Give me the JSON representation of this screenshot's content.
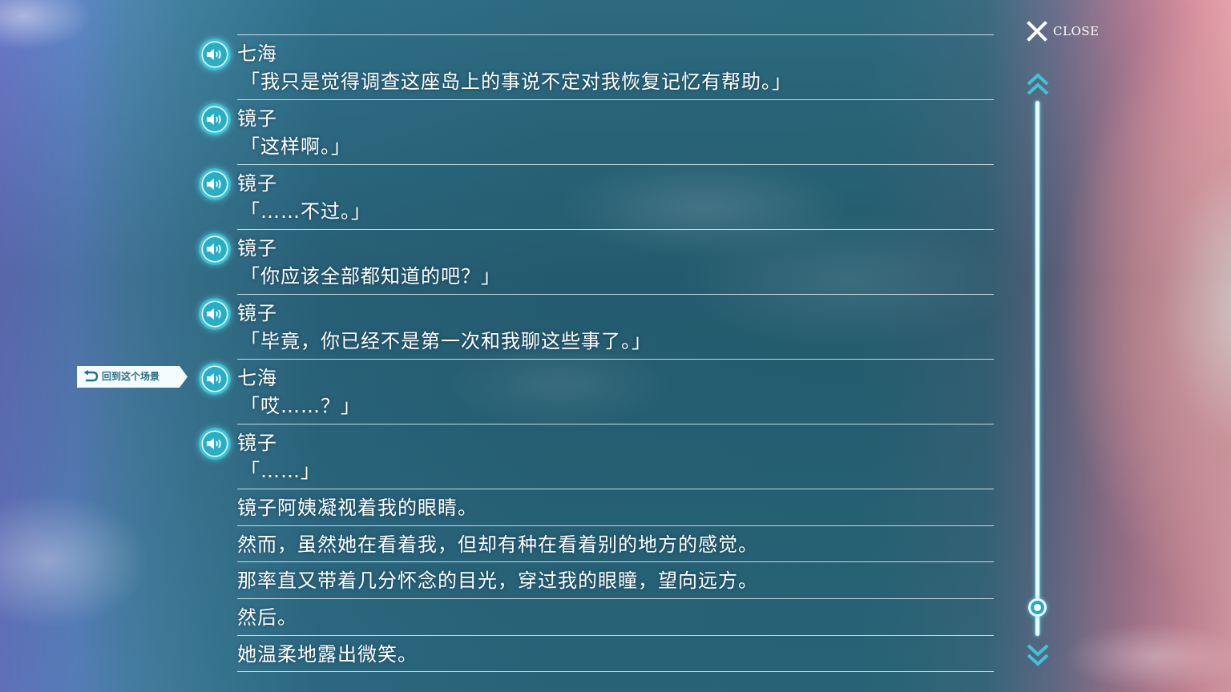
{
  "backlog": {
    "entries": [
      {
        "type": "voiced",
        "speaker": "七海",
        "text": "「我只是觉得调查这座岛上的事说不定对我恢复记忆有帮助。」"
      },
      {
        "type": "voiced",
        "speaker": "镜子",
        "text": "「这样啊。」"
      },
      {
        "type": "voiced",
        "speaker": "镜子",
        "text": "「……不过。」"
      },
      {
        "type": "voiced",
        "speaker": "镜子",
        "text": "「你应该全部都知道的吧？」"
      },
      {
        "type": "voiced",
        "speaker": "镜子",
        "text": "「毕竟，你已经不是第一次和我聊这些事了。」"
      },
      {
        "type": "voiced",
        "speaker": "七海",
        "text": "「哎……？」"
      },
      {
        "type": "voiced",
        "speaker": "镜子",
        "text": "「……」"
      },
      {
        "type": "narration",
        "text": "镜子阿姨凝视着我的眼睛。"
      },
      {
        "type": "narration",
        "text": "然而，虽然她在看着我，但却有种在看着别的地方的感觉。"
      },
      {
        "type": "narration",
        "text": "那率直又带着几分怀念的目光，穿过我的眼瞳，望向远方。"
      },
      {
        "type": "narration",
        "text": "然后。"
      },
      {
        "type": "narration",
        "text": "她温柔地露出微笑。"
      }
    ]
  },
  "jump_button": {
    "label": "回到这个场景",
    "icon": "return-arrow-icon"
  },
  "close_button": {
    "label": "CLOSE",
    "icon": "x-icon"
  },
  "scrollbar": {
    "position": 0.93
  },
  "colors": {
    "accent": "#2aaec6",
    "glow": "#5adcf0",
    "text": "#ffffff"
  }
}
